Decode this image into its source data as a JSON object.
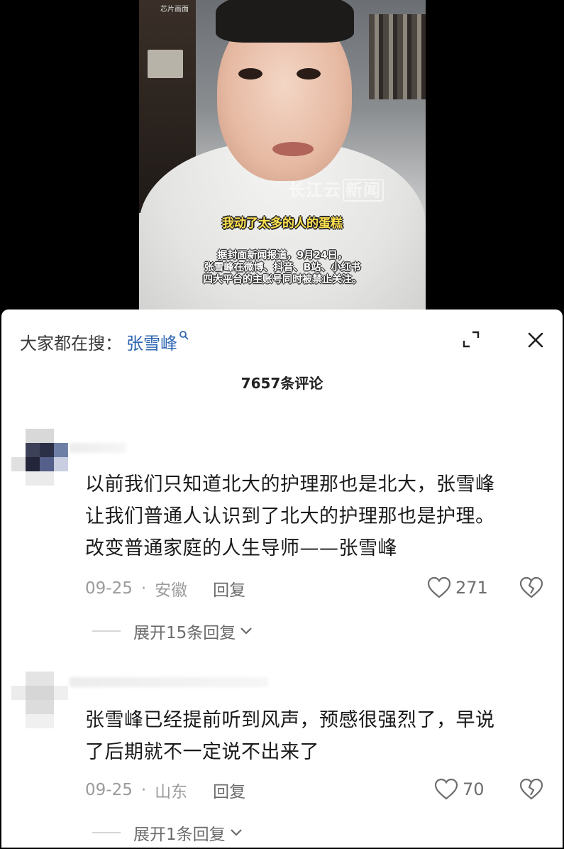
{
  "video": {
    "top_watermark": "芯片画面",
    "logo_text": "长江云",
    "logo_boxed": "新闻",
    "caption_highlight": "我动了太多的人的蛋糕",
    "caption_lines": [
      "据封面新闻报道，9月24日，",
      "张雪峰在微博、抖音、B站、小红书",
      "四大平台的主账号同时被禁止关注。"
    ]
  },
  "search": {
    "prefix": "大家都在搜：",
    "term": "张雪峰"
  },
  "comment_count": "7657条评论",
  "comments": [
    {
      "text_lines": [
        "以前我们只知道北大的护理那也是北大，张雪峰",
        "让我们普通人认识到了北大的护理那也是护理。",
        "改变普通家庭的人生导师——张雪峰"
      ],
      "date": "09-25",
      "location": "安徽",
      "reply_label": "回复",
      "likes": "271",
      "expand_label": "展开15条回复"
    },
    {
      "text_lines": [
        "张雪峰已经提前听到风声，预感很强烈了，早说",
        "了后期就不一定说不出来了"
      ],
      "date": "09-25",
      "location": "山东",
      "reply_label": "回复",
      "likes": "70",
      "expand_label": "展开1条回复"
    }
  ],
  "colors": {
    "accent_blue": "#2f67b2",
    "caption_yellow": "#ffe14d",
    "meta_gray": "#9b9b9b"
  }
}
